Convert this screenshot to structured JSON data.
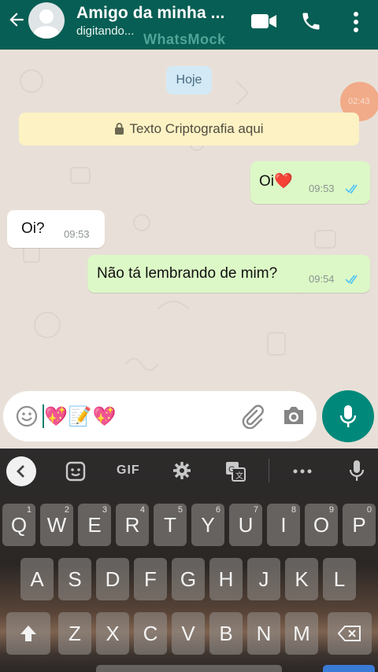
{
  "header": {
    "contact_name": "Amigo da minha ...",
    "status": "digitando...",
    "watermark": "WhatsMock",
    "icons": [
      "back-arrow-icon",
      "avatar",
      "video-call-icon",
      "phone-icon",
      "more-vert-icon"
    ]
  },
  "chat": {
    "date_chip": "Hoje",
    "crypto_notice": "Texto Criptografia aqui",
    "overlay_badge": "02:43",
    "messages": [
      {
        "direction": "out",
        "text": "Oi❤️",
        "time": "09:53",
        "status": "read"
      },
      {
        "direction": "in",
        "text": "Oi?",
        "time": "09:53"
      },
      {
        "direction": "out",
        "text": "Não tá lembrando de mim?",
        "time": "09:54",
        "status": "read"
      }
    ]
  },
  "composer": {
    "value": "💖📝💖",
    "icons": [
      "emoji-icon",
      "attach-icon",
      "camera-icon",
      "mic-icon"
    ]
  },
  "keyboard": {
    "toolbar": [
      "back-chevron-icon",
      "sticker-icon",
      "GIF",
      "settings-icon",
      "translate-icon",
      "more-dots-icon",
      "voice-mic-icon"
    ],
    "gif_label": "GIF",
    "row1": [
      {
        "key": "Q",
        "hint": "1"
      },
      {
        "key": "W",
        "hint": "2"
      },
      {
        "key": "E",
        "hint": "3"
      },
      {
        "key": "R",
        "hint": "4"
      },
      {
        "key": "T",
        "hint": "5"
      },
      {
        "key": "Y",
        "hint": "6"
      },
      {
        "key": "U",
        "hint": "7"
      },
      {
        "key": "I",
        "hint": "8"
      },
      {
        "key": "O",
        "hint": "9"
      },
      {
        "key": "P",
        "hint": "0"
      }
    ],
    "row2": [
      "A",
      "S",
      "D",
      "F",
      "G",
      "H",
      "J",
      "K",
      "L"
    ],
    "row3": [
      "Z",
      "X",
      "C",
      "V",
      "B",
      "N",
      "M"
    ]
  },
  "colors": {
    "header": "#075e54",
    "outgoing_bubble": "#dcf8c6",
    "incoming_bubble": "#ffffff",
    "accent": "#00897b",
    "read_ticks": "#4fc3f7"
  }
}
